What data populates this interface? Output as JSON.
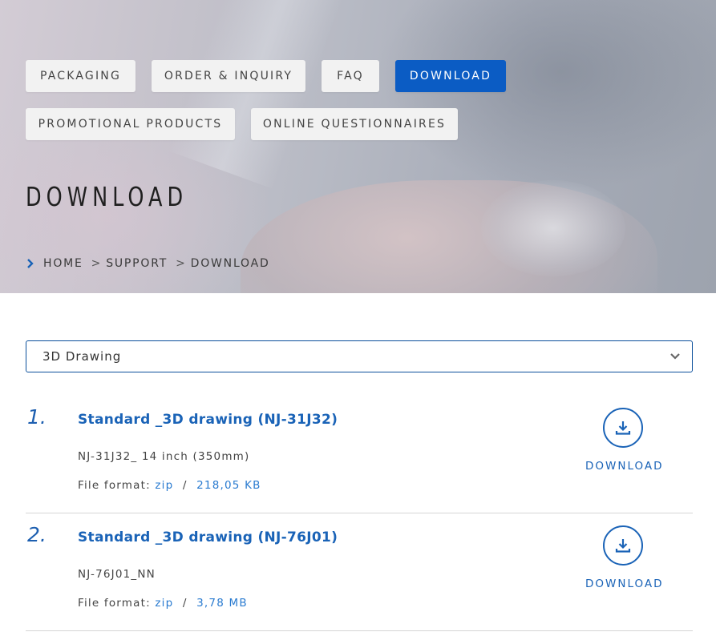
{
  "nav": {
    "packaging": "PACKAGING",
    "order_inquiry": "ORDER & INQUIRY",
    "faq": "FAQ",
    "download": "DOWNLOAD",
    "promotional": "PROMOTIONAL PRODUCTS",
    "questionnaires": "ONLINE QUESTIONNAIRES"
  },
  "page_title": "DOWNLOAD",
  "breadcrumb": {
    "home": "HOME",
    "support": "SUPPORT",
    "current": "DOWNLOAD",
    "separator": ">"
  },
  "category_select": {
    "value": "3D Drawing"
  },
  "items": [
    {
      "number": "1.",
      "title": "Standard _3D drawing (NJ-31J32)",
      "subtitle": "NJ-31J32_ 14 inch (350mm)",
      "format_label": "File format:",
      "format": "zip",
      "separator": "/",
      "size": "218,05 KB",
      "download_label": "DOWNLOAD"
    },
    {
      "number": "2.",
      "title": "Standard _3D drawing (NJ-76J01)",
      "subtitle": "NJ-76J01_NN",
      "format_label": "File format:",
      "format": "zip",
      "separator": "/",
      "size": "3,78 MB",
      "download_label": "DOWNLOAD"
    }
  ],
  "colors": {
    "accent": "#0b5cc4",
    "link": "#1a63b7",
    "meta_link": "#2a7bd0"
  }
}
